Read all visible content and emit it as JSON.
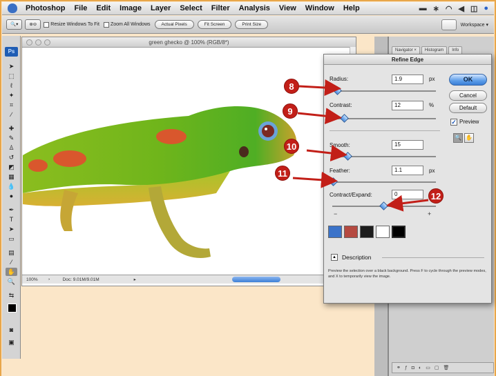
{
  "menubar": {
    "app": "Photoshop",
    "items": [
      "File",
      "Edit",
      "Image",
      "Layer",
      "Select",
      "Filter",
      "Analysis",
      "View",
      "Window",
      "Help"
    ]
  },
  "options_bar": {
    "resize_windows": "Resize Windows To Fit",
    "zoom_all": "Zoom All Windows",
    "actual_pixels": "Actual Pixels",
    "fit_screen": "Fit Screen",
    "print_size": "Print Size",
    "workspace": "Workspace ▾"
  },
  "tools": {
    "logo": "Ps"
  },
  "document": {
    "title": "green ghecko @ 100% (RGB/8*)",
    "zoom": "100%",
    "doc_info": "Doc: 9.01M/9.01M"
  },
  "panels": {
    "tabs": [
      "Navigator ×",
      "Histogram",
      "Info"
    ]
  },
  "dialog": {
    "title": "Refine Edge",
    "radius": {
      "label": "Radius:",
      "value": "1.9",
      "unit": "px",
      "slider": 0.05
    },
    "contrast": {
      "label": "Contrast:",
      "value": "12",
      "unit": "%",
      "slider": 0.12
    },
    "smooth": {
      "label": "Smooth:",
      "value": "15",
      "slider": 0.15
    },
    "feather": {
      "label": "Feather:",
      "value": "1.1",
      "unit": "px",
      "slider": 0.01
    },
    "contract": {
      "label": "Contract/Expand:",
      "value": "0",
      "slider": 0.5,
      "minus": "−",
      "plus": "+"
    },
    "buttons": {
      "ok": "OK",
      "cancel": "Cancel",
      "default": "Default"
    },
    "preview_label": "Preview",
    "description_label": "Description",
    "description_text": "Preview the selection over a black background. Press F to cycle through the preview modes, and X to temporarily view the image."
  },
  "callouts": [
    "8",
    "9",
    "10",
    "11",
    "12"
  ],
  "colors": {
    "callout": "#c21f18",
    "frame": "#e8a64a",
    "accent": "#3a7fd6"
  }
}
